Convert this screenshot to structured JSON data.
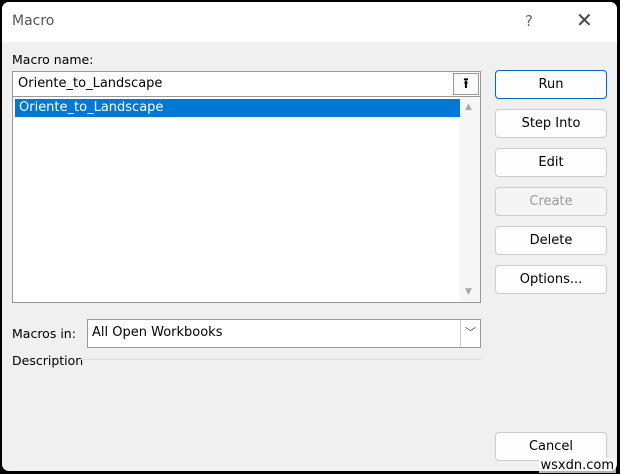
{
  "window": {
    "title": "Macro",
    "help": "?",
    "close": "✕"
  },
  "macro_name": {
    "label": "Macro name:",
    "value": "Oriente_to_Landscape",
    "upload_icon": "⭱"
  },
  "macro_list": {
    "items": [
      "Oriente_to_Landscape"
    ],
    "selected": 0
  },
  "buttons": {
    "run": "Run",
    "step_into": "Step Into",
    "edit": "Edit",
    "create": "Create",
    "delete": "Delete",
    "options": "Options...",
    "cancel": "Cancel"
  },
  "macros_in": {
    "label": "Macros in:",
    "value": "All Open Workbooks"
  },
  "description": {
    "label": "Description"
  },
  "watermark": "wsxdn.com",
  "colors": {
    "selection": "#0078d4",
    "accent_border": "#0067c0"
  }
}
